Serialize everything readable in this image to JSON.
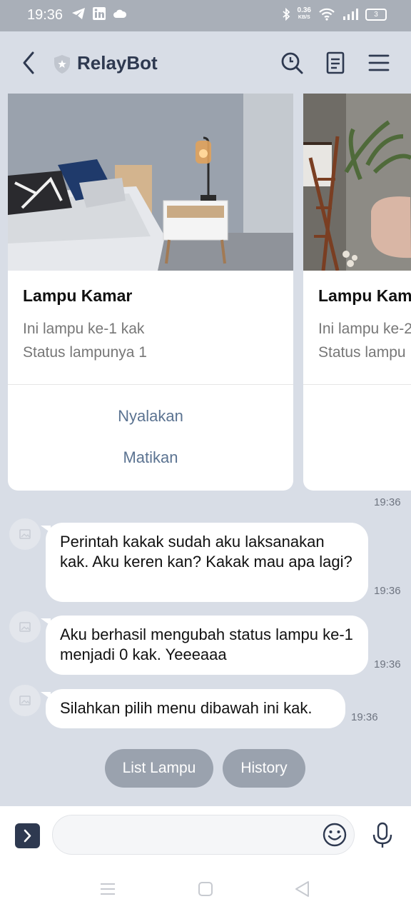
{
  "status_bar": {
    "time": "19:36",
    "speed_value": "0.36",
    "speed_unit": "KB/S",
    "battery": "3",
    "icons_left": [
      "telegram-icon",
      "linkedin-icon",
      "cloud-icon"
    ],
    "icons_right": [
      "bluetooth-icon",
      "wifi-icon",
      "signal-icon",
      "battery-icon"
    ]
  },
  "header": {
    "title": "RelayBot",
    "icons": [
      "back-icon",
      "shield-icon",
      "search-icon",
      "notes-icon",
      "menu-icon"
    ]
  },
  "cards": [
    {
      "title": "Lampu Kamar",
      "line1": "Ini lampu ke-1 kak",
      "line2": "Status lampunya 1",
      "action_on": "Nyalakan",
      "action_off": "Matikan"
    },
    {
      "title": "Lampu Kam",
      "line1": "Ini lampu ke-2",
      "line2": "Status lampu"
    }
  ],
  "carousel_time": "19:36",
  "messages": [
    {
      "text": "Perintah kakak sudah aku laksanakan kak. Aku keren kan? Kakak mau apa lagi?",
      "time": "19:36"
    },
    {
      "text": "Aku berhasil mengubah status lampu ke-1 menjadi 0 kak. Yeeeaaa",
      "time": "19:36"
    },
    {
      "text": "Silahkan pilih menu dibawah ini kak.",
      "time": "19:36"
    }
  ],
  "quick_replies": [
    "List Lampu",
    "History"
  ],
  "composer": {
    "placeholder": ""
  },
  "colors": {
    "header_bg": "#d8dde6",
    "accent": "#2e3950",
    "link": "#5b7391",
    "chip": "#9aa2ae"
  }
}
